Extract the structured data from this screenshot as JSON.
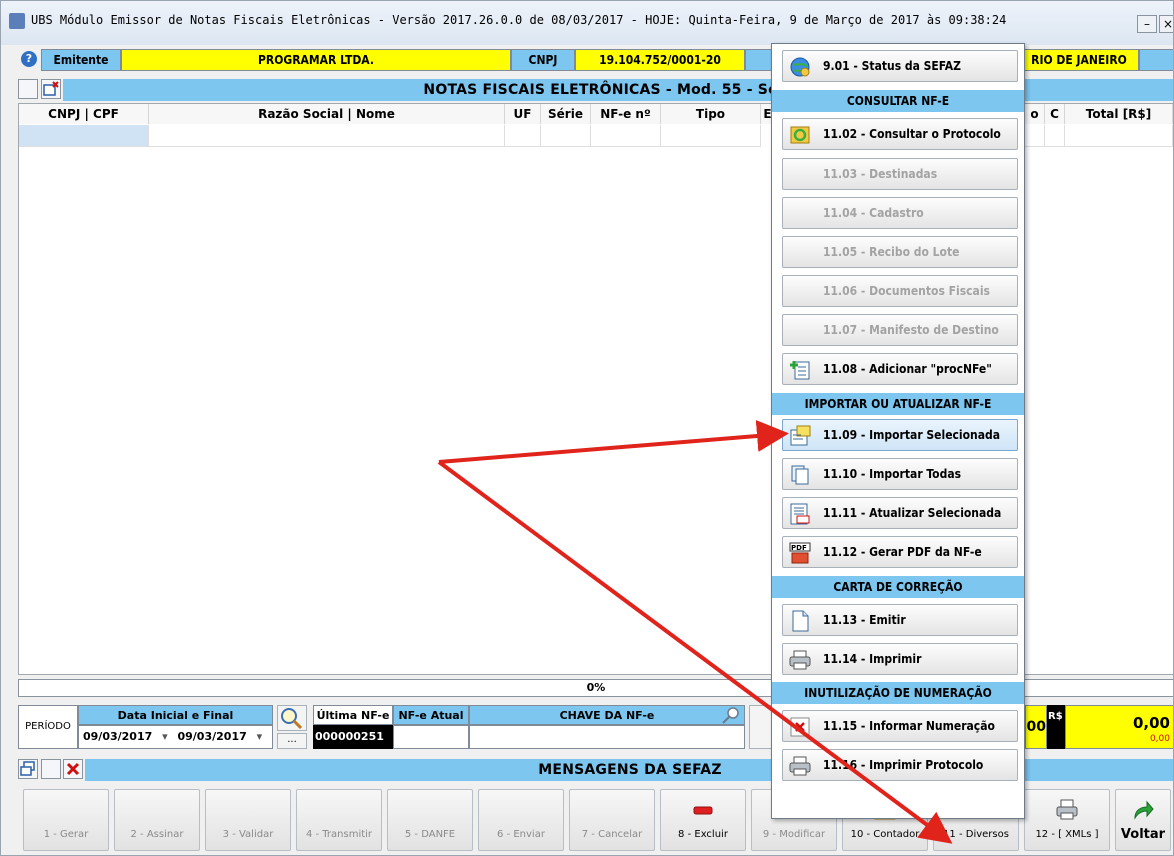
{
  "window": {
    "title": "UBS Módulo Emissor de Notas Fiscais Eletrônicas - Versão 2017.26.0.0 de 08/03/2017 - HOJE: Quinta-Feira,  9 de Março de 2017 às 09:38:24",
    "minimize": "–",
    "close": "×"
  },
  "header": {
    "help": "?",
    "emitente_label": "Emitente",
    "emitente_value": "PROGRAMAR LTDA.",
    "cnpj_label": "CNPJ",
    "cnpj_value": "19.104.752/0001-20",
    "city_value": "RIO DE JANEIRO"
  },
  "band_title": "NOTAS FISCAIS ELETRÔNICAS - Mod. 55 - Série 0",
  "table": {
    "columns": [
      "CNPJ | CPF",
      "Razão Social | Nome",
      "UF",
      "Série",
      "NF-e nº",
      "Tipo",
      "E",
      "o",
      "C",
      "Total [R$]"
    ]
  },
  "progress": "0%",
  "bottom": {
    "periodo": "PERÍODO",
    "data_label": "Data Inicial e Final",
    "date_start": "09/03/2017",
    "date_end": "09/03/2017",
    "ellipsis": "...",
    "ultima_label": "Última NF-e",
    "ultima_value": "000000251",
    "atual_label": "NF-e Atual",
    "chave_label": "CHAVE DA NF-e",
    "partial_value": "00",
    "rs_label": "R$",
    "total_value": "0,00",
    "total_small": "0,00",
    "mensagens": "MENSAGENS DA SEFAZ"
  },
  "toolbar": [
    {
      "label": "1 - Gerar"
    },
    {
      "label": "2 - Assinar"
    },
    {
      "label": "3 - Validar"
    },
    {
      "label": "4 - Transmitir"
    },
    {
      "label": "5 - DANFE"
    },
    {
      "label": "6 - Enviar"
    },
    {
      "label": "7 - Cancelar"
    },
    {
      "label": "8 - Excluir"
    },
    {
      "label": "9 - Modificar"
    },
    {
      "label": "10 - Contador"
    },
    {
      "label": "11 - Diversos"
    },
    {
      "label": "12 - [ XMLs ]"
    },
    {
      "label": "Voltar"
    }
  ],
  "menu": {
    "item_901": "9.01 - Status da SEFAZ",
    "sec_consultar": "CONSULTAR NF-E",
    "item_1102": "11.02 - Consultar o Protocolo",
    "item_1103": "11.03 - Destinadas",
    "item_1104": "11.04 - Cadastro",
    "item_1105": "11.05 - Recibo do Lote",
    "item_1106": "11.06 - Documentos Fiscais",
    "item_1107": "11.07 - Manifesto de Destino",
    "item_1108": "11.08 - Adicionar \"procNFe\"",
    "sec_importar": "IMPORTAR OU ATUALIZAR NF-E",
    "item_1109": "11.09 - Importar Selecionada",
    "item_1110": "11.10 - Importar Todas",
    "item_1111": "11.11 - Atualizar Selecionada",
    "item_1112": "11.12 - Gerar PDF da NF-e",
    "sec_carta": "CARTA DE CORREÇÃO",
    "item_1113": "11.13 - Emitir",
    "item_1114": "11.14 - Imprimir",
    "sec_inutil": "INUTILIZAÇÃO DE NUMERAÇÃO",
    "item_1115": "11.15 - Informar Numeração",
    "item_1116": "11.16 - Imprimir Protocolo"
  },
  "colors": {
    "band": "#7cc6f0",
    "highlight": "#ffff00",
    "arrow": "#e0231b"
  }
}
